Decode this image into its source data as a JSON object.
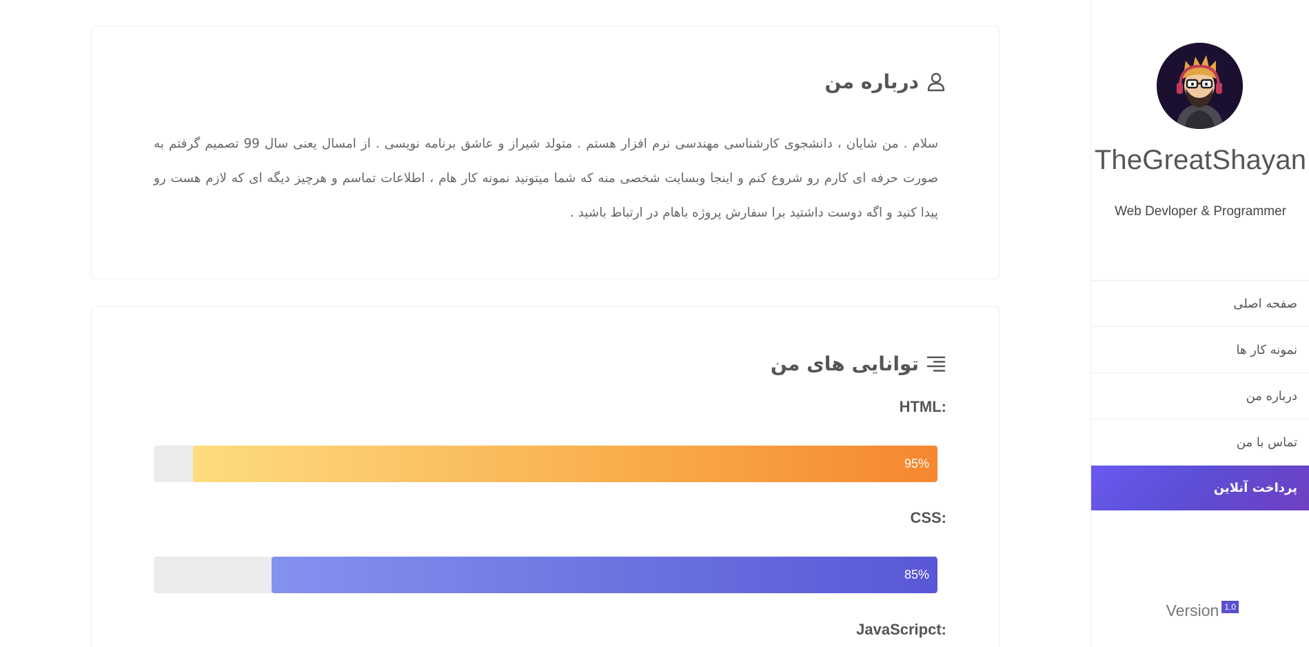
{
  "sidebar": {
    "avatar_alt": "avatar",
    "name": "TheGreatShayan",
    "role": "Web Devloper & Programmer",
    "nav_items": [
      {
        "label": "صفحه اصلی",
        "active": false
      },
      {
        "label": "نمونه کار ها",
        "active": false
      },
      {
        "label": "درباره من",
        "active": false
      },
      {
        "label": "تماس با من",
        "active": false
      },
      {
        "label": "پرداخت آنلاین",
        "active": true
      }
    ],
    "version_label": "Version",
    "version_number": "1.0"
  },
  "about": {
    "title": "درباره من",
    "icon": "user-icon",
    "text": "سلام . من شایان ، دانشجوی کارشناسی مهندسی نرم افزار هستم . متولد شیراز و عاشق برنامه نویسی . از امسال یعنی سال 99 تصمیم گرفتم به صورت حرفه ای کارم رو شروع کنم و اینجا وبسایت شخصی منه که شما میتونید نمونه کار هام ، اطلاعات تماسم و هرچیز دیگه ای که لازم هست رو پیدا کنید و اگه دوست داشتید برا سفارش پروژه باهام در ارتباط باشید ."
  },
  "skills": {
    "title": "توانایی های من",
    "icon": "align-right-icon",
    "items": [
      {
        "label": "HTML:",
        "percent_text": "95%",
        "level": 95,
        "color": "#f5872f"
      },
      {
        "label": "CSS:",
        "percent_text": "85%",
        "level": 85,
        "color": "#5957d6"
      },
      {
        "label": "JavaScripct:"
      }
    ]
  },
  "colors": {
    "accent": "#5c4fd6",
    "html_bar": "#f5872f",
    "css_bar": "#5957d6",
    "track": "#ebebeb"
  }
}
